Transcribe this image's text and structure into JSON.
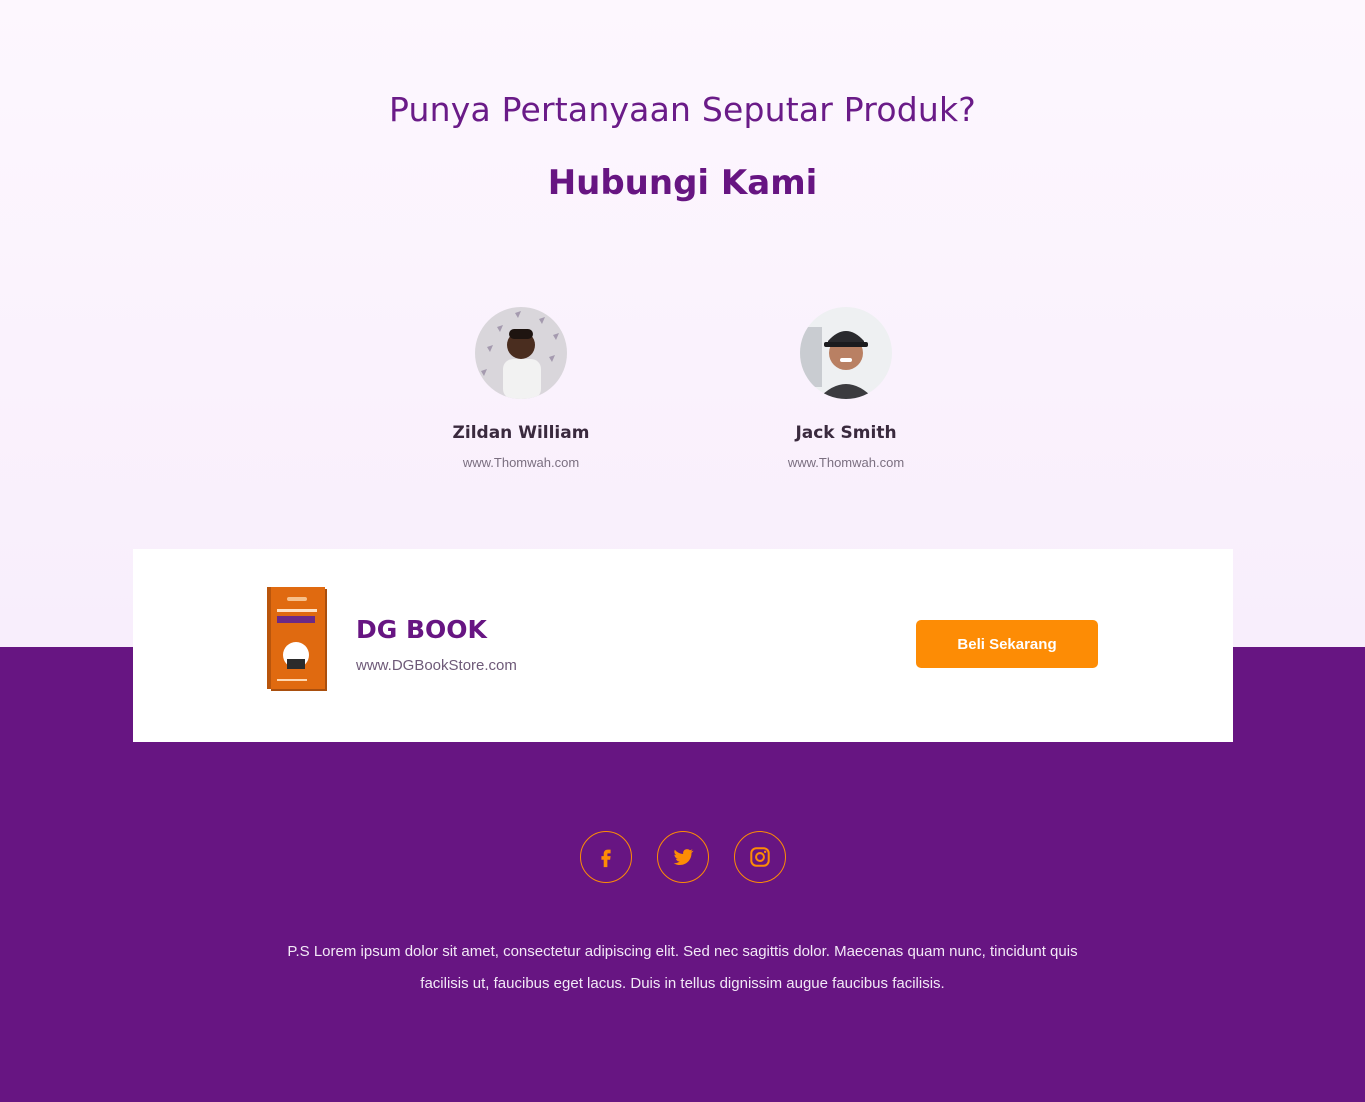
{
  "header": {
    "question": "Punya Pertanyaan Seputar Produk?",
    "title": "Hubungi Kami"
  },
  "contacts": [
    {
      "name": "Zildan William",
      "website": "www.Thomwah.com"
    },
    {
      "name": "Jack Smith",
      "website": "www.Thomwah.com"
    }
  ],
  "product": {
    "brand": "DG BOOK",
    "url": "www.DGBookStore.com",
    "buy_label": "Beli Sekarang"
  },
  "social": [
    "facebook-icon",
    "twitter-icon",
    "instagram-icon"
  ],
  "footer": {
    "text": "P.S Lorem ipsum dolor sit amet, consectetur adipiscing elit. Sed nec sagittis dolor. Maecenas quam nunc, tincidunt quis facilisis ut, faucibus eget lacus. Duis in tellus dignissim augue faucibus facilisis."
  },
  "colors": {
    "primary": "#671582",
    "accent": "#fd8c05",
    "background_top": "#fbf3fd"
  }
}
